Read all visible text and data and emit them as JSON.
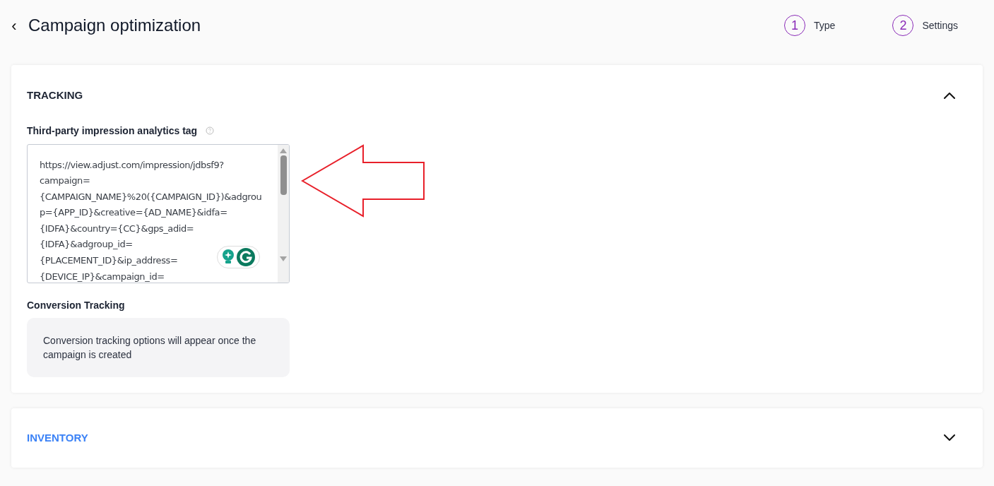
{
  "header": {
    "back": "‹",
    "title": "Campaign optimization"
  },
  "steps": [
    {
      "number": "1",
      "label": "Type"
    },
    {
      "number": "2",
      "label": "Settings"
    }
  ],
  "sections": [
    {
      "title": "TRACKING",
      "expanded": true
    },
    {
      "title": "INVENTORY",
      "expanded": false
    }
  ],
  "tracking": {
    "tag_label": "Third-party impression analytics tag",
    "tag_value": [
      "https://view.adjust.com/impression/jdbsf9?",
      "campaign=",
      "{CAMPAIGN_NAME}%20({CAMPAIGN_ID})&adgrou",
      "p={APP_ID}&creative={AD_NAME}&idfa=",
      "{IDFA}&country={CC}&gps_adid=",
      "{IDFA}&adgroup_id=",
      "{PLACEMENT_ID}&ip_address=",
      "{DEVICE_IP}&campaign_id="
    ],
    "conversion_label": "Conversion Tracking",
    "conversion_note": "Conversion tracking options will appear once the campaign is created"
  }
}
